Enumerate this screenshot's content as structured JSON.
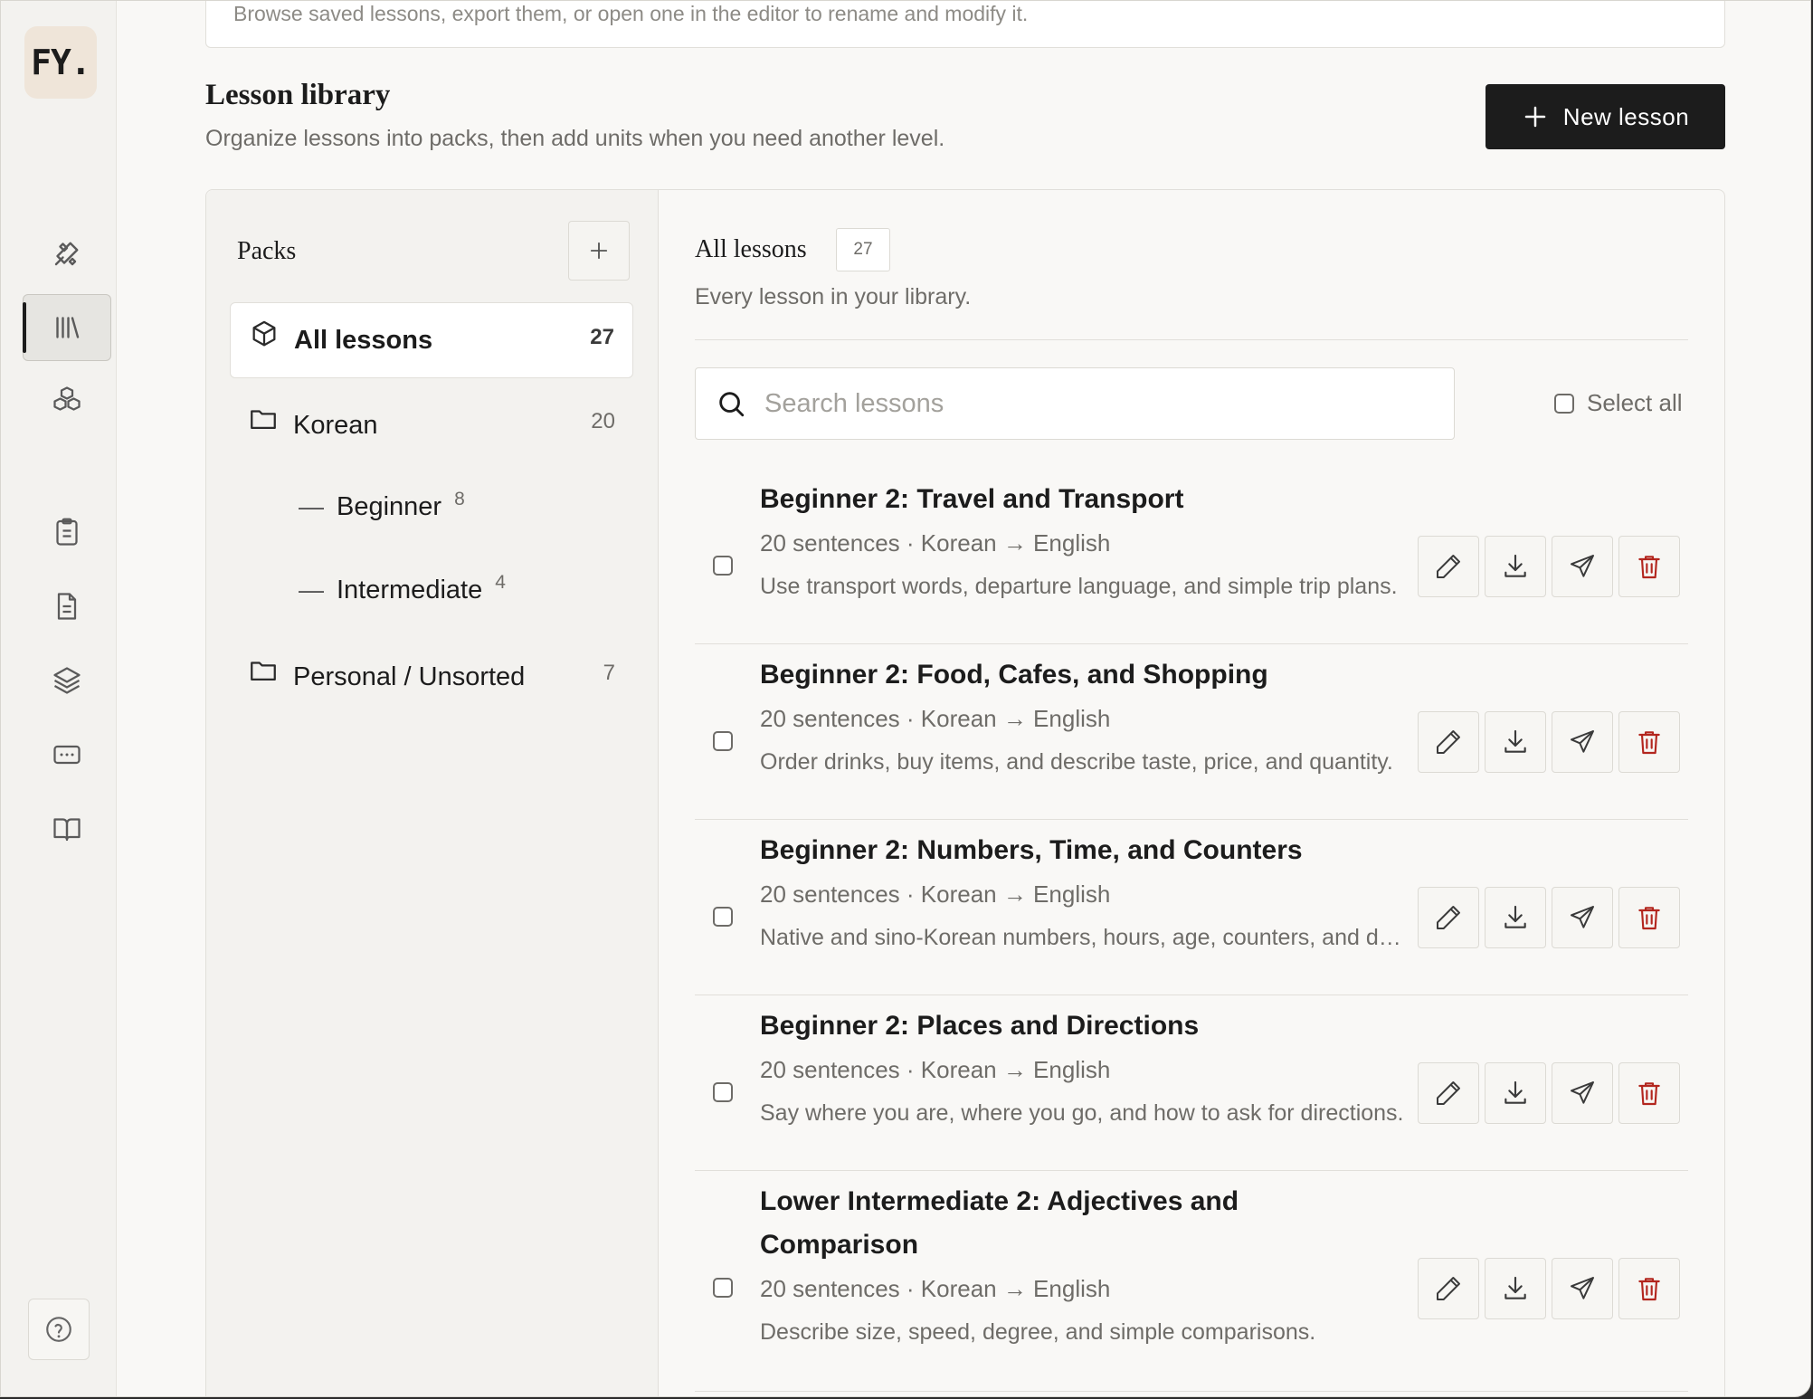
{
  "app": {
    "logo_text": "FY."
  },
  "rail": {
    "items": [
      {
        "icon": "tools-icon"
      },
      {
        "icon": "library-icon",
        "active": true
      },
      {
        "icon": "boxes-icon"
      },
      {
        "icon": "clipboard-icon"
      },
      {
        "icon": "file-text-icon"
      },
      {
        "icon": "layers-icon"
      },
      {
        "icon": "keyboard-icon"
      },
      {
        "icon": "book-open-icon"
      }
    ],
    "help_icon": "help-circle-icon"
  },
  "top_card": {
    "text": "Browse saved lessons, export them, or open one in the editor to rename and modify it."
  },
  "library": {
    "title": "Lesson library",
    "subtitle": "Organize lessons into packs, then add units when you need another level.",
    "new_button": "New lesson"
  },
  "packs": {
    "title": "Packs",
    "items": [
      {
        "label": "All lessons",
        "count": "27",
        "icon": "package-icon",
        "active": true
      },
      {
        "label": "Korean",
        "count": "20",
        "icon": "folder-icon"
      },
      {
        "label": "Personal / Unsorted",
        "count": "7",
        "icon": "folder-icon"
      }
    ],
    "units": [
      {
        "dash": "—",
        "label": "Beginner",
        "count": "8"
      },
      {
        "dash": "—",
        "label": "Intermediate",
        "count": "4"
      }
    ]
  },
  "lessons": {
    "title": "All lessons",
    "count": "27",
    "subtitle": "Every lesson in your library.",
    "search_placeholder": "Search lessons",
    "select_all": "Select all",
    "rows": [
      {
        "title": "Beginner 2: Travel and Transport",
        "meta": "20 sentences · Korean → English",
        "desc": "Use transport words, departure language, and simple trip plans."
      },
      {
        "title": "Beginner 2: Food, Cafes, and Shopping",
        "meta": "20 sentences · Korean → English",
        "desc": "Order drinks, buy items, and describe taste, price, and quantity."
      },
      {
        "title": "Beginner 2: Numbers, Time, and Counters",
        "meta": "20 sentences · Korean → English",
        "desc": "Native and sino-Korean numbers, hours, age, counters, and dates."
      },
      {
        "title": "Beginner 2: Places and Directions",
        "meta": "20 sentences · Korean → English",
        "desc": "Say where you are, where you go, and how to ask for directions."
      },
      {
        "title": "Lower Intermediate 2: Adjectives and Comparison",
        "meta": "20 sentences · Korean → English",
        "desc": "Describe size, speed, degree, and simple comparisons."
      }
    ]
  },
  "colors": {
    "accent": "#1c1c1c",
    "danger": "#b3261e",
    "logo_bg": "#efe5d9"
  }
}
